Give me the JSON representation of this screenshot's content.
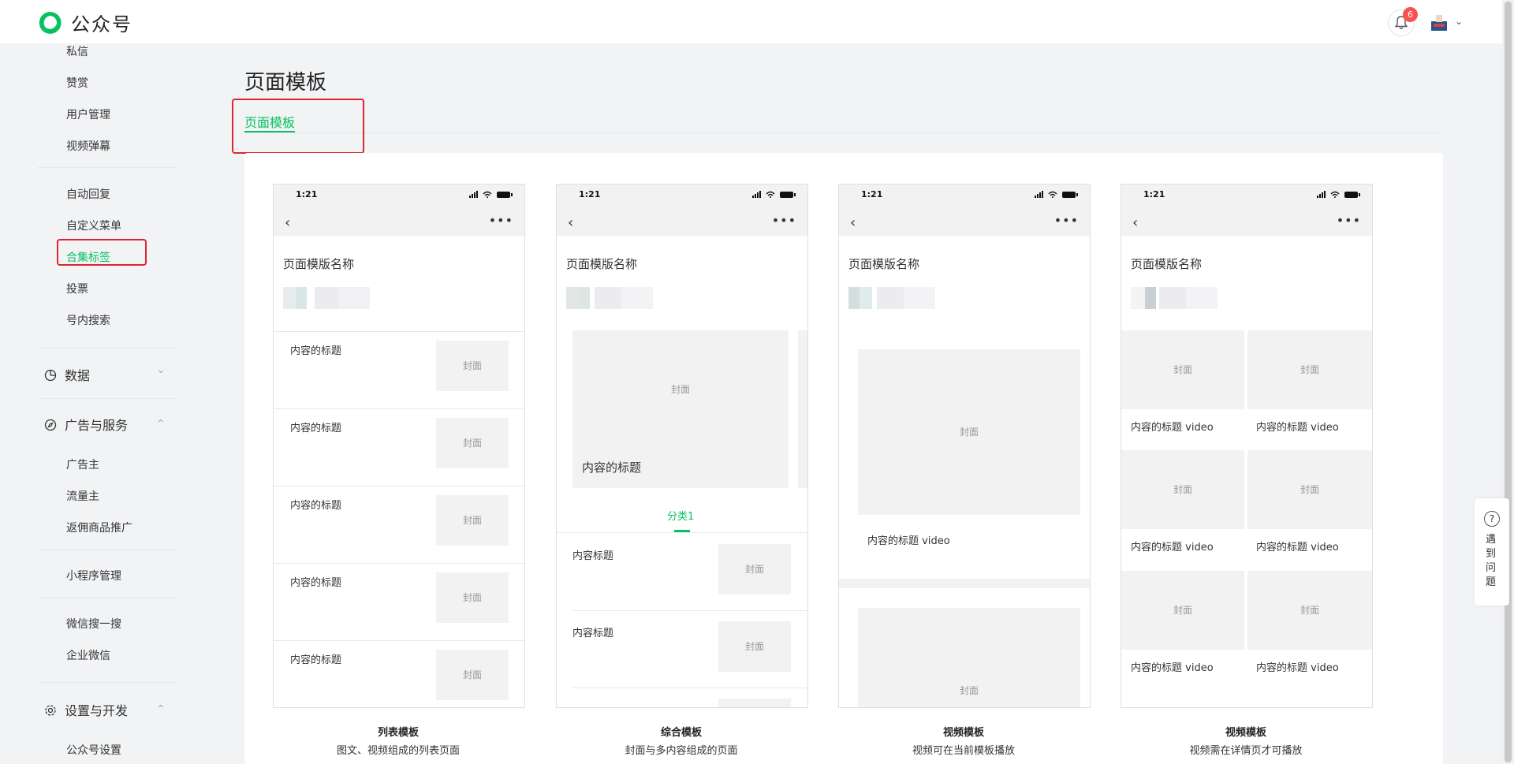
{
  "header": {
    "brand": "公众号",
    "notification_count": "6"
  },
  "sidebar": {
    "items_top": [
      "私信",
      "赞赏",
      "用户管理",
      "视频弹幕"
    ],
    "items_group2": [
      "自动回复",
      "自定义菜单",
      "合集标签",
      "投票",
      "号内搜索"
    ],
    "active_item": "合集标签",
    "section_data": "数据",
    "section_ads": "广告与服务",
    "ads_items": [
      "广告主",
      "流量主",
      "返佣商品推广"
    ],
    "item_miniprogram": "小程序管理",
    "items_group5": [
      "微信搜一搜",
      "企业微信"
    ],
    "section_settings": "设置与开发",
    "settings_items": [
      "公众号设置"
    ]
  },
  "main": {
    "title": "页面模板",
    "tab_label": "页面模板"
  },
  "phone_common": {
    "time": "1:21",
    "page_name": "页面模版名称",
    "cover": "封面"
  },
  "templates": [
    {
      "name": "列表模板",
      "desc": "图文、视频组成的列表页面",
      "items": [
        "内容的标题",
        "内容的标题",
        "内容的标题",
        "内容的标题",
        "内容的标题"
      ]
    },
    {
      "name": "综合模板",
      "desc": "封面与多内容组成的页面",
      "hero_title": "内容的标题",
      "category": "分类1",
      "items": [
        "内容标题",
        "内容标题"
      ]
    },
    {
      "name": "视频模板",
      "desc": "视频可在当前模板播放",
      "video_title": "内容的标题 video"
    },
    {
      "name": "视频模板",
      "desc": "视频需在详情页才可播放",
      "grid_titles": [
        "内容的标题 video",
        "内容的标题 video",
        "内容的标题 video",
        "内容的标题 video",
        "内容的标题 video",
        "内容的标题 video"
      ]
    }
  ],
  "help": {
    "icon": "?",
    "label": "遇到问题"
  },
  "colors": {
    "accent": "#07c160",
    "highlight": "#e0242f",
    "badge": "#fa5151"
  }
}
